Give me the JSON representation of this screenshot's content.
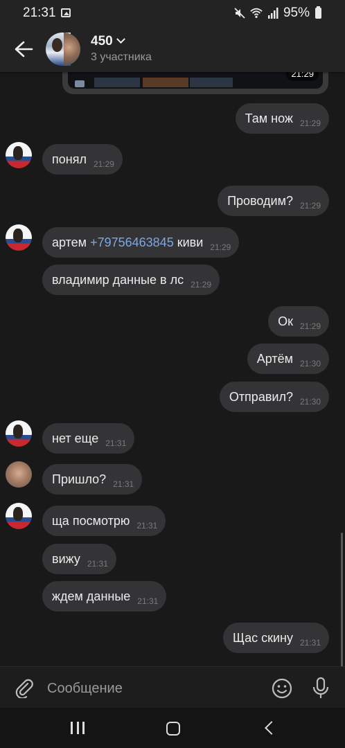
{
  "status_bar": {
    "time": "21:31",
    "battery": "95%",
    "icons": [
      "gallery-icon",
      "mute-icon",
      "wifi-icon",
      "signal-icon",
      "battery-icon"
    ]
  },
  "header": {
    "title": "450",
    "subtitle": "3 участника"
  },
  "image_message": {
    "time": "21:29"
  },
  "messages": [
    {
      "dir": "out",
      "text": "Там нож",
      "time": "21:29"
    },
    {
      "dir": "in",
      "avatar": "flag",
      "text": "понял",
      "time": "21:29"
    },
    {
      "dir": "out",
      "text": "Проводим?",
      "time": "21:29"
    },
    {
      "dir": "in",
      "avatar": "flag",
      "text_before": "артем",
      "link": "+79756463845",
      "text_after": "киви",
      "time": "21:29"
    },
    {
      "dir": "in",
      "text": "владимир данные в лс",
      "time": "21:29"
    },
    {
      "dir": "out",
      "text": "Ок",
      "time": "21:29"
    },
    {
      "dir": "out",
      "text": "Артём",
      "time": "21:30"
    },
    {
      "dir": "out",
      "text": "Отправил?",
      "time": "21:30"
    },
    {
      "dir": "in",
      "avatar": "flag",
      "text": "нет еще",
      "time": "21:31"
    },
    {
      "dir": "in",
      "avatar": "face",
      "text": "Пришло?",
      "time": "21:31"
    },
    {
      "dir": "in",
      "avatar": "flag",
      "text": "ща посмотрю",
      "time": "21:31"
    },
    {
      "dir": "in",
      "text": "вижу",
      "time": "21:31"
    },
    {
      "dir": "in",
      "text": "ждем данные",
      "time": "21:31"
    },
    {
      "dir": "out",
      "text": "Щас скину",
      "time": "21:31"
    }
  ],
  "composer": {
    "placeholder": "Сообщение"
  },
  "colors": {
    "background": "#19191a",
    "bubble": "#343436",
    "link": "#7fa7e0",
    "timestamp": "#7a7a7a"
  }
}
